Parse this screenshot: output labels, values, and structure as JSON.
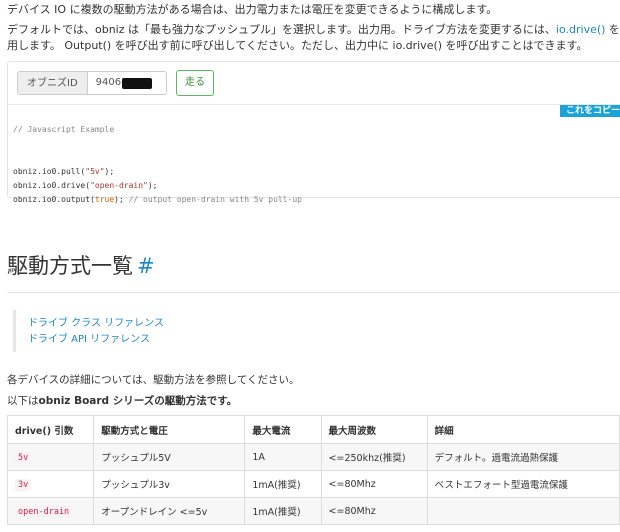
{
  "intro": {
    "line1": "デバイス IO に複数の駆動方法がある場合は、出力電力または電圧を変更できるように構成します。",
    "line2_a": "デフォルトでは、obniz は「最も強力なプッシュプル」を選択します。出力用。ドライブ方法を変更するには、",
    "line2_link": "io.drive()",
    "line2_b": " を使",
    "line3_a": "用します。 Output() を呼び出す前に呼び出してください。ただし、出力中に ",
    "line3_code": "io.drive()",
    "line3_b": " を呼び出すことはできます。"
  },
  "runner": {
    "id_label": "オブニズID",
    "id_value": "9406-",
    "run_label": "走る",
    "copy_label": "これをコピー"
  },
  "code": {
    "comment": "// Javascript Example",
    "l1_a": "obniz.io0.pull(",
    "l1_s": "\"5v\"",
    "l1_b": ");",
    "l2_a": "obniz.io0.drive(",
    "l2_s": "\"open-drain\"",
    "l2_b": ");",
    "l3_a": "obniz.io0.output(",
    "l3_k": "true",
    "l3_b": "); ",
    "l3_c": "// output open-drain with 5v pull-up"
  },
  "section": {
    "title": "駆動方式一覧",
    "anchor": "#"
  },
  "refs": {
    "class_ref": "ドライブ クラス リファレンス",
    "api_ref": "ドライブ API リファレンス"
  },
  "details": {
    "line1": "各デバイスの詳細については、駆動方法を参照してください。",
    "line2_a": "以下は",
    "line2_b": "obniz Board シリーズの駆動方法です。"
  },
  "table": {
    "headers": [
      "drive() 引数",
      "駆動方式と電圧",
      "最大電流",
      "最大周波数",
      "詳細"
    ],
    "rows": [
      [
        "5v",
        "プッシュプル5V",
        "1A",
        "<=250khz(推奨)",
        "デフォルト。過電流過熱保護"
      ],
      [
        "3v",
        "プッシュプル3v",
        "1mA(推奨)",
        "<=80Mhz",
        "ベストエフォート型過電流保護"
      ],
      [
        "open-drain",
        "オープンドレイン <=5v",
        "1mA(推奨)",
        "<=80Mhz",
        ""
      ]
    ]
  }
}
